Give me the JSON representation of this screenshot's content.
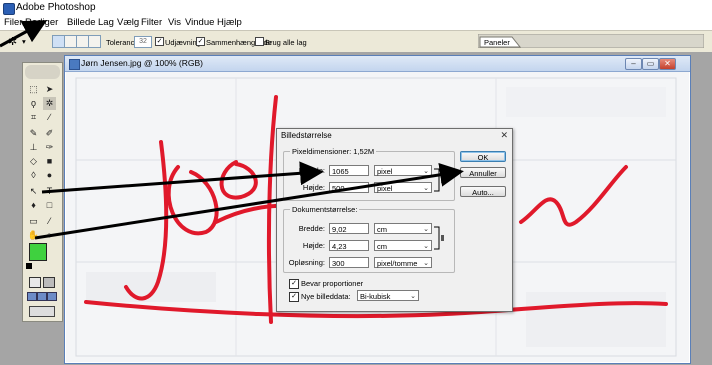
{
  "app": {
    "title": "Adobe Photoshop"
  },
  "menu": [
    "Filer",
    "Rediger",
    "Billede",
    "Lag",
    "Vælg",
    "Filter",
    "Vis",
    "Vindue",
    "Hjælp"
  ],
  "options_bar": {
    "tolerance_label": "Tolerance:",
    "tolerance_value": "32",
    "anti_alias_label": "Udjævning",
    "contiguous_label": "Sammenhængende",
    "all_layers_label": "Brug alle lag",
    "palette_tab": "Paneler"
  },
  "document": {
    "title": "Jørn Jensen.jpg @ 100% (RGB)"
  },
  "dialog": {
    "title": "Billedstørrelse",
    "pixel_dims_label": "Pixeldimensioner:",
    "pixel_dims_value": "1,52M",
    "width_label": "Bredde:",
    "width_value": "1065",
    "width_unit": "pixel",
    "height_label": "Højde:",
    "height_value": "500",
    "height_unit": "pixel",
    "doc_size_label": "Dokumentstørrelse:",
    "doc_width_label": "Bredde:",
    "doc_width_value": "9,02",
    "doc_width_unit": "cm",
    "doc_height_label": "Højde:",
    "doc_height_value": "4,23",
    "doc_height_unit": "cm",
    "resolution_label": "Opløsning:",
    "resolution_value": "300",
    "resolution_unit": "pixel/tomme",
    "constrain_label": "Bevar proportioner",
    "resample_label": "Nye billeddata:",
    "resample_value": "Bi-kubisk",
    "ok": "OK",
    "cancel": "Annuller",
    "auto": "Auto..."
  },
  "colors": {
    "signature": "#e0192b",
    "arrow": "#000000",
    "foreground": "#3fd13f"
  }
}
